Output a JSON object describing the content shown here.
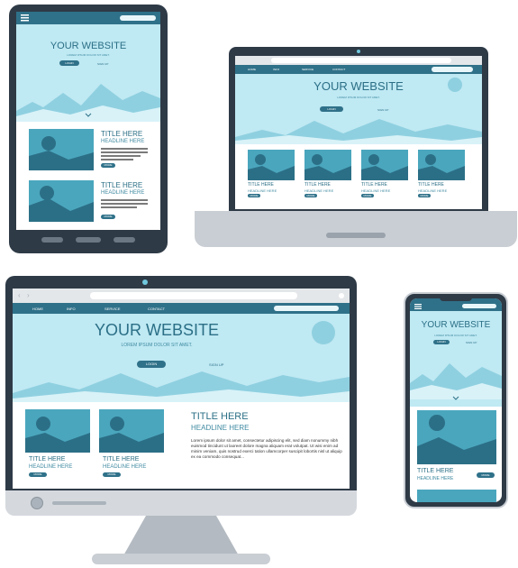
{
  "hero": {
    "title": "YOUR WEBSITE",
    "tagline": "LOREM IPSUM DOLOR SIT AMET.",
    "login_label": "LOGIN",
    "signup_label": "SIGN UP"
  },
  "nav": {
    "items": [
      "HOME",
      "INFO",
      "SERVICE",
      "CONTACT"
    ]
  },
  "cards": {
    "title": "TITLE HERE",
    "headline": "HEADLINE HERE",
    "more_label": "MORE",
    "body": "Lorem ipsum dolor sit amet, consectetur adipiscing elit, sed diam nonummy nibh euismod tincidunt ut laoreet dolore magna aliquam erat volutpat. Ut wisi enim ad minim veniam, quis nostrud exerci tation ullamcorper suscipit lobortis nisl ut aliquip ex ea commodo consequat..."
  },
  "colors": {
    "primary": "#2f7189",
    "hero_bg": "#bfe9f3",
    "device_frame": "#2e3a46",
    "device_silver": "#c9ced4"
  },
  "icons": [
    "hamburger-menu-icon",
    "search-icon",
    "camera-dot-icon",
    "sun-icon",
    "mountain-landscape-icon",
    "chevron-down-icon"
  ]
}
